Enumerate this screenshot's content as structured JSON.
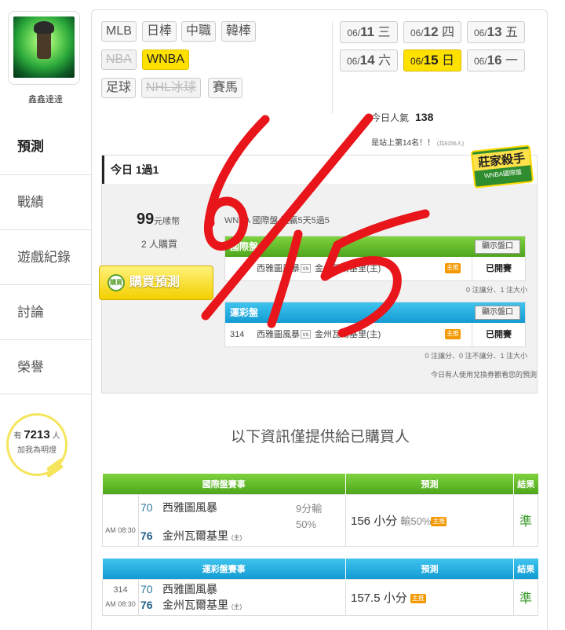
{
  "user": {
    "name": "鑫鑫達達"
  },
  "sidebar": {
    "items": [
      {
        "label": "預測",
        "active": true
      },
      {
        "label": "戰績",
        "active": false
      },
      {
        "label": "遊戲紀錄",
        "active": false
      },
      {
        "label": "討論",
        "active": false
      },
      {
        "label": "榮譽",
        "active": false
      }
    ],
    "fans": {
      "prefix": "有",
      "count": "7213",
      "suffix": "人",
      "cta": "加我為明燈"
    }
  },
  "sports": [
    {
      "label": "MLB",
      "state": "normal"
    },
    {
      "label": "日棒",
      "state": "normal"
    },
    {
      "label": "中職",
      "state": "normal"
    },
    {
      "label": "韓棒",
      "state": "normal"
    },
    {
      "label": "NBA",
      "state": "disabled"
    },
    {
      "label": "WNBA",
      "state": "active"
    },
    {
      "label": "足球",
      "state": "normal"
    },
    {
      "label": "NHL冰球",
      "state": "disabled"
    },
    {
      "label": "賽馬",
      "state": "normal"
    }
  ],
  "dates": [
    {
      "md": "06/",
      "d": "11",
      "w": "三",
      "active": false
    },
    {
      "md": "06/",
      "d": "12",
      "w": "四",
      "active": false
    },
    {
      "md": "06/",
      "d": "13",
      "w": "五",
      "active": false
    },
    {
      "md": "06/",
      "d": "14",
      "w": "六",
      "active": false
    },
    {
      "md": "06/",
      "d": "15",
      "w": "日",
      "active": true
    },
    {
      "md": "06/",
      "d": "16",
      "w": "一",
      "active": false
    }
  ],
  "popularity": {
    "label": "今日人氣",
    "value": "138",
    "rank_text": "是站上第14名！！",
    "rank_note": "(共8156人)"
  },
  "today": {
    "title": "今日 1過1",
    "badge_title": "莊家殺手",
    "badge_sub": "WNBA國際盤",
    "price": "99",
    "price_unit": "元嗉幣",
    "buyers": "2 人購買",
    "buy_label": "購買預測",
    "buy_icon_text": "購買",
    "record_text": "WNBA 國際盤 連贏5天5過5",
    "intl": {
      "header": "國際盤",
      "toggle": "顯示盤口",
      "away": "西雅圖風暴",
      "vs": "vs",
      "home": "金州瓦爾基里(主)",
      "host_tag": "主推",
      "status": "已開賽",
      "note": "0 注讓分、1 注大小"
    },
    "lottery": {
      "header": "運彩盤",
      "toggle": "顯示盤口",
      "num": "314",
      "away": "西雅圖風暴",
      "vs": "vs",
      "home": "金州瓦爾基里(主)",
      "host_tag": "主推",
      "status": "已開賽",
      "note": "0 注讓分、0 注不讓分、1 注大小"
    },
    "exchange_note": "今日有人使用兌換券觀看您的預測"
  },
  "info_title": "以下資訊僅提供給已購買人",
  "results": {
    "intl": {
      "h_game": "國際盤賽事",
      "h_pred": "預測",
      "h_res": "結果",
      "time": "AM 08:30",
      "away_score": "70",
      "away": "西雅圖風暴",
      "home_score": "76",
      "home": "金州瓦爾基里",
      "zhu": "(主)",
      "margin": "9分輸",
      "margin_pct": "50%",
      "prediction": "156 小分",
      "pred_lose": "輸50%",
      "tag": "主推",
      "result": "準"
    },
    "lottery": {
      "h_game": "運彩盤賽事",
      "h_pred": "預測",
      "h_res": "結果",
      "num": "314",
      "time": "AM 08:30",
      "away_score": "70",
      "away": "西雅圖風暴",
      "home_score": "76",
      "home": "金州瓦爾基里",
      "zhu": "(主)",
      "prediction": "157.5 小分",
      "tag": "主推",
      "result": "準"
    }
  },
  "overlay": {
    "handwritten": "6/15",
    "color": "#e8151a"
  },
  "colors": {
    "accent_yellow": "#ffe100",
    "green_header": "#5bb326",
    "blue_header": "#1ea8dc",
    "host_tag": "#f39800"
  }
}
